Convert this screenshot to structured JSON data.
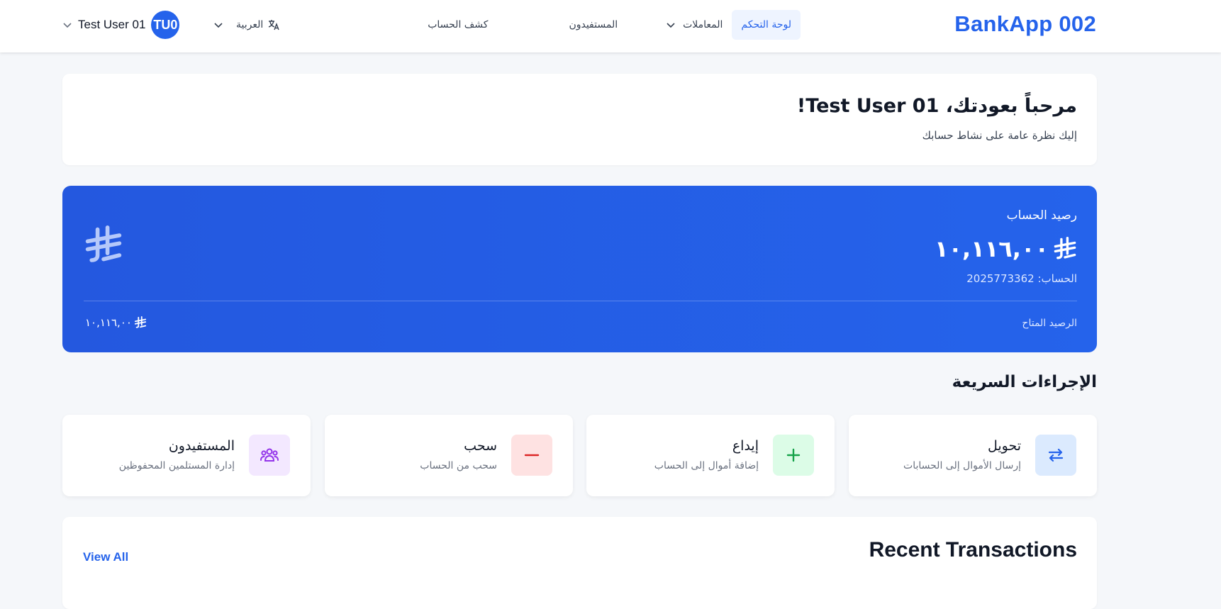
{
  "header": {
    "brand": "BankApp 002",
    "nav": {
      "dashboard": "لوحة التحكم",
      "transactions": "المعاملات",
      "beneficiaries": "المستفيدون",
      "statement": "كشف الحساب"
    },
    "language": "العربية",
    "user": {
      "name": "Test User 01",
      "initials": "TU0"
    }
  },
  "welcome": {
    "title": "مرحباً بعودتك، Test User 01!",
    "subtitle": "إليك نظرة عامة على نشاط حسابك"
  },
  "balance": {
    "label": "رصيد الحساب",
    "amount": "١٠,١١٦,٠٠",
    "account_label": "الحساب:",
    "account_number": "2025773362",
    "available_label": "الرصيد المتاح",
    "available_amount": "١٠,١١٦,٠٠"
  },
  "quick_actions": {
    "title": "الإجراءات السريعة",
    "items": [
      {
        "title": "تحويل",
        "desc": "إرسال الأموال إلى الحسابات",
        "icon": "transfer-icon",
        "bg": "#dbeafe",
        "fg": "#2563eb"
      },
      {
        "title": "إيداع",
        "desc": "إضافة أموال إلى الحساب",
        "icon": "plus-icon",
        "bg": "#dcfce7",
        "fg": "#16a34a"
      },
      {
        "title": "سحب",
        "desc": "سحب من الحساب",
        "icon": "minus-icon",
        "bg": "#fee2e2",
        "fg": "#dc2626"
      },
      {
        "title": "المستفيدون",
        "desc": "إدارة المستلمين المحفوظين",
        "icon": "users-icon",
        "bg": "#f3e8ff",
        "fg": "#9333ea"
      }
    ]
  },
  "recent": {
    "title": "Recent Transactions",
    "view_all": "View All"
  },
  "colors": {
    "accent": "#2563eb"
  }
}
